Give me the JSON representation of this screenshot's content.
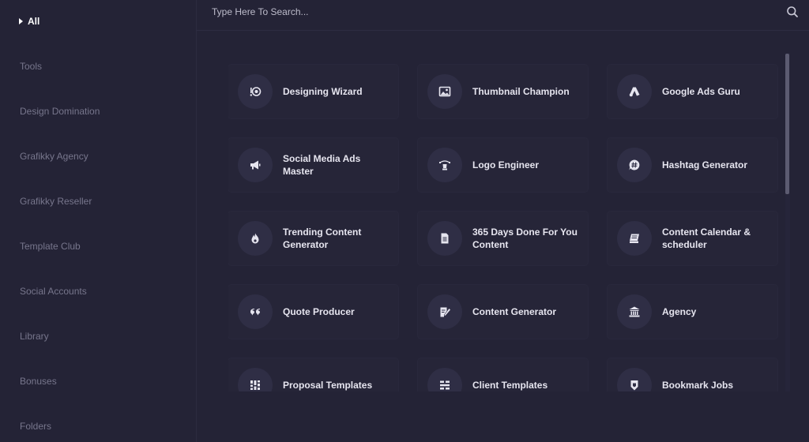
{
  "sidebar": {
    "items": [
      {
        "label": "All",
        "active": true
      },
      {
        "label": "Tools"
      },
      {
        "label": "Design Domination"
      },
      {
        "label": "Grafikky Agency"
      },
      {
        "label": "Grafikky Reseller"
      },
      {
        "label": "Template Club"
      },
      {
        "label": "Social Accounts"
      },
      {
        "label": "Library"
      },
      {
        "label": "Bonuses"
      },
      {
        "label": "Folders"
      }
    ]
  },
  "search": {
    "placeholder": "Type Here To Search...",
    "value": "",
    "icon": "search-icon"
  },
  "cards": [
    {
      "label": "Designing Wizard",
      "icon": "design-wizard-icon"
    },
    {
      "label": "Thumbnail Champion",
      "icon": "image-icon"
    },
    {
      "label": "Google Ads Guru",
      "icon": "google-ads-icon"
    },
    {
      "label": "Social Media Ads Master",
      "icon": "megaphone-icon"
    },
    {
      "label": "Logo Engineer",
      "icon": "logo-pen-icon"
    },
    {
      "label": "Hashtag Generator",
      "icon": "hashtag-icon"
    },
    {
      "label": "Trending Content Generator",
      "icon": "flame-icon"
    },
    {
      "label": "365 Days Done For You Content",
      "icon": "document-icon"
    },
    {
      "label": "Content Calendar & scheduler",
      "icon": "calendar-icon"
    },
    {
      "label": "Quote Producer",
      "icon": "quote-icon"
    },
    {
      "label": "Content Generator",
      "icon": "edit-document-icon"
    },
    {
      "label": "Agency",
      "icon": "bank-icon"
    },
    {
      "label": "Proposal Templates",
      "icon": "proposal-grid-icon"
    },
    {
      "label": "Client Templates",
      "icon": "client-grid-icon"
    },
    {
      "label": "Bookmark Jobs",
      "icon": "bookmark-shield-icon"
    }
  ],
  "colors": {
    "background": "#242336",
    "card": "#262538",
    "icon_circle": "#2f2e45",
    "text_primary": "#e6e5ef",
    "text_muted": "#77768c"
  }
}
